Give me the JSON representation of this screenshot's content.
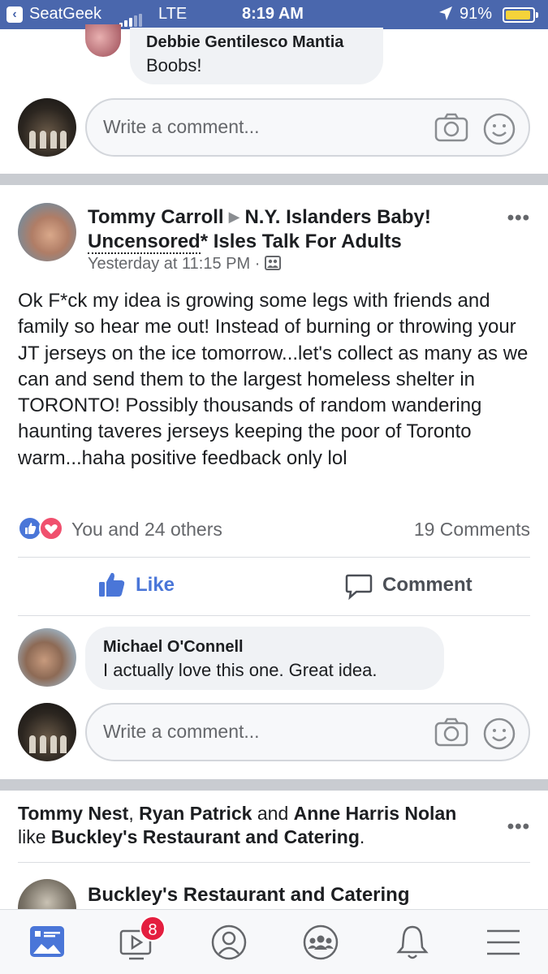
{
  "status_bar": {
    "back_app": "SeatGeek",
    "network": "LTE",
    "time": "8:19 AM",
    "battery": "91%"
  },
  "top_comment": {
    "author": "Debbie Gentilesco Mantia",
    "text": "Boobs!"
  },
  "comment_input": {
    "placeholder": "Write a comment..."
  },
  "post": {
    "author": "Tommy Carroll",
    "group_line1_a": "N.Y. Islanders Baby!",
    "group_line2_dotted": "Uncensored",
    "group_line2_rest": "* Isles Talk For Adults",
    "timestamp": "Yesterday at 11:15 PM",
    "meta_sep": "·",
    "body": "Ok F*ck my idea is growing some legs with friends and family so hear me out! Instead of burning or throwing your JT jerseys on the ice tomorrow...let's collect as many as we can and send them to the largest homeless shelter in TORONTO! Possibly thousands of random wandering haunting taveres jerseys keeping the poor of Toronto warm...haha positive feedback only lol",
    "reactions_text": "You and 24 others",
    "comments_count": "19 Comments",
    "like_label": "Like",
    "comment_label": "Comment",
    "more": "•••"
  },
  "post_comment": {
    "author": "Michael O'Connell",
    "text": "I actually love this one. Great idea."
  },
  "activity": {
    "name1": "Tommy Nest",
    "sep1": ", ",
    "name2": "Ryan Patrick",
    "and": " and ",
    "name3": "Anne Harris Nolan",
    "like": " like ",
    "page": "Buckley's Restaurant and Catering",
    "end": "."
  },
  "next_post": {
    "author": "Buckley's Restaurant and Catering"
  },
  "tabbar": {
    "video_badge": "8"
  },
  "colors": {
    "status_bar": "#4a67ad",
    "like_blue": "#4a76d8",
    "love_red": "#f0506e",
    "badge_red": "#e41e3f"
  }
}
